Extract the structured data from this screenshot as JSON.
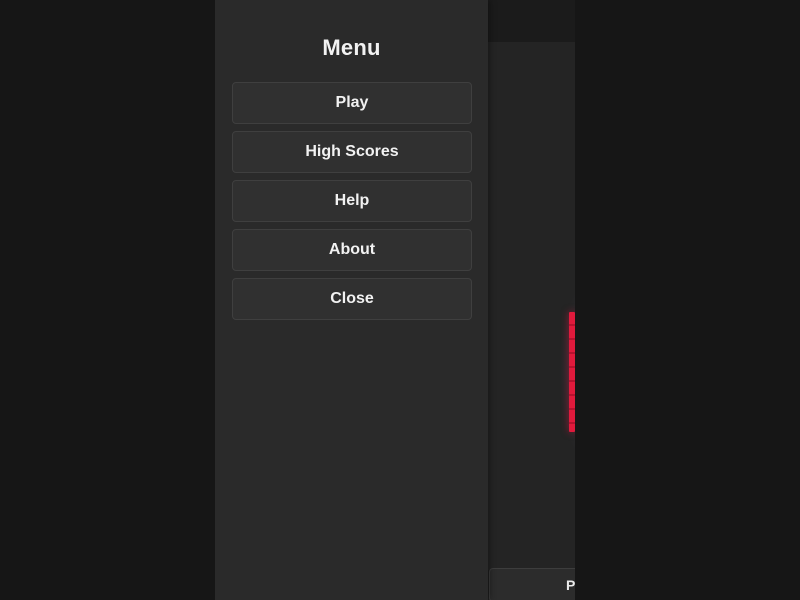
{
  "menu": {
    "title": "Menu",
    "items": [
      {
        "label": "Play"
      },
      {
        "label": "High Scores"
      },
      {
        "label": "Help"
      },
      {
        "label": "About"
      },
      {
        "label": "Close"
      }
    ]
  },
  "game": {
    "bottom_button_label": "P",
    "snake_color": "#e01a3c"
  }
}
